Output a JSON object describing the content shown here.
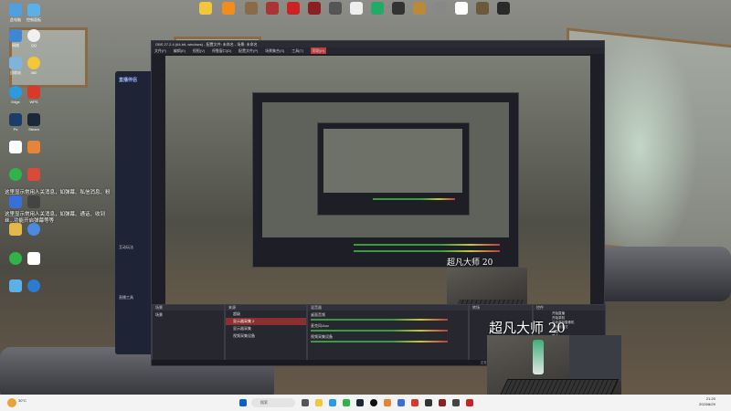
{
  "obs": {
    "title": "OBS 27.2.4 (64-bit, windows) - 配置文件: 未命名 - 场景: 未命名",
    "menu": [
      "文件(F)",
      "编辑(E)",
      "视图(V)",
      "停靠窗口(D)",
      "配置文件(P)",
      "场景集合(S)",
      "工具(T)",
      "帮助(H)"
    ],
    "scenes_label": "场景",
    "scene_item": "场景",
    "sources_label": "来源",
    "sources": [
      "超级",
      "显示器采集 2",
      "显示器采集",
      "视频采集设备"
    ],
    "mixer_label": "混音器",
    "mixer_tracks": [
      {
        "name": "桌面音频",
        "level": "0.0 dB"
      },
      {
        "name": "麦克风/Aux",
        "level": "0.0 dB"
      },
      {
        "name": "视频采集设备",
        "level": "0.0 dB"
      }
    ],
    "transitions_label": "转场",
    "controls_label": "控件",
    "controls": [
      "开始直播",
      "开始录制",
      "启动虚拟摄像机",
      "工作室模式",
      "设置",
      "退出"
    ],
    "statusbar": "正在录制"
  },
  "overlay": {
    "name_large": "超凡大师 20",
    "name_small": "超凡大师 20"
  },
  "desktop_text": {
    "line1": "这里显示常用人关消息，如弹幕、私信消息、粉",
    "line2": "这里显示常用人关消息，如弹幕、通话、收到",
    "line3": "丝...功能开启弹幕等等"
  },
  "stream_app": {
    "title": "直播伴侣",
    "sections": [
      "互动玩法",
      "直播工具"
    ]
  },
  "taskbar": {
    "search_placeholder": "搜索",
    "weather": "30°C",
    "time": "21:20",
    "date": "2023/8/29"
  },
  "colors": {
    "obs_bg": "#1e1f26",
    "record_red": "#c23c3c",
    "meter_green": "#3c9b3c",
    "taskbar_bg": "#f3f3f3"
  }
}
